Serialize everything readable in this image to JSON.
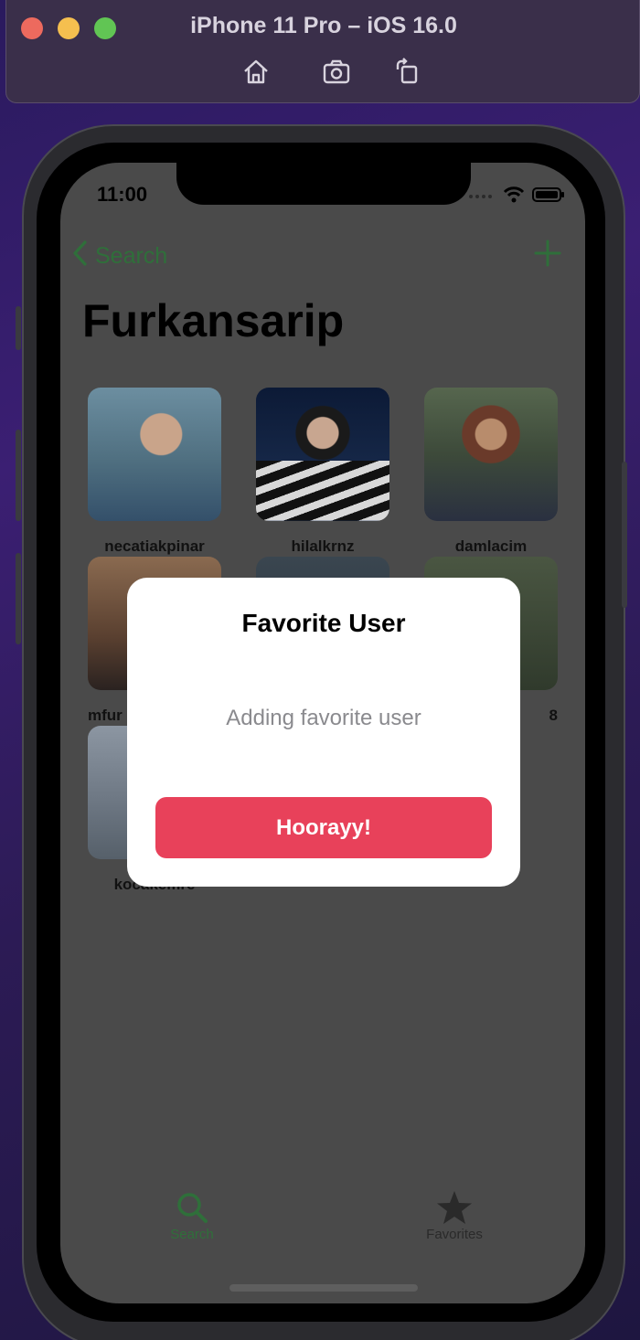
{
  "simulator": {
    "title": "iPhone 11 Pro – iOS 16.0",
    "tools": [
      "home-icon",
      "screenshot-icon",
      "rotate-icon"
    ]
  },
  "status_bar": {
    "time": "11:00"
  },
  "nav": {
    "back_label": "Search",
    "add_icon": "plus-icon"
  },
  "page": {
    "title": "Furkansarip"
  },
  "users": [
    {
      "name": "necatiakpinar",
      "color": "#5b7a8c"
    },
    {
      "name": "hilalkrnz",
      "color": "#1d2a3f"
    },
    {
      "name": "damlacim",
      "color": "#4a5a48"
    },
    {
      "name": "mfur",
      "color": "#6a5040"
    },
    {
      "name": "",
      "color": "#2e3a42"
    },
    {
      "name": "8",
      "color": "#3a4636"
    },
    {
      "name": "kocakemre",
      "color": "#7a8490"
    }
  ],
  "alert": {
    "title": "Favorite User",
    "message": "Adding favorite user",
    "button": "Hoorayy!"
  },
  "tabs": [
    {
      "label": "Search",
      "icon": "search-icon",
      "color": "#2f6f3a"
    },
    {
      "label": "Favorites",
      "icon": "star-icon",
      "color": "#2a2a2a"
    }
  ],
  "colors": {
    "accent": "#2f6f3a",
    "alert_button": "#e8415a"
  }
}
